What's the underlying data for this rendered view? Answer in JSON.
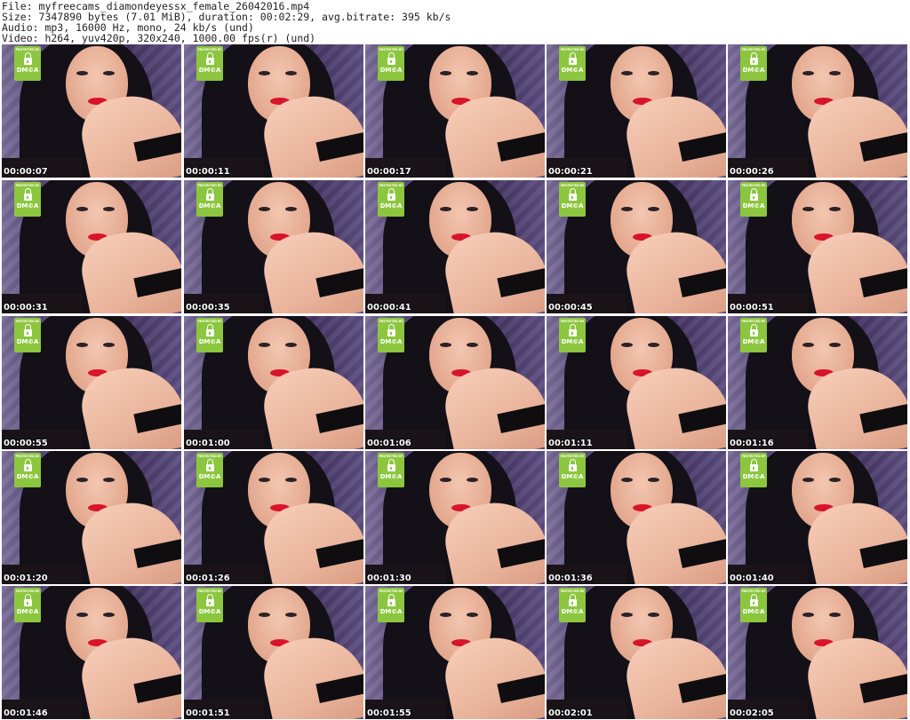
{
  "header": {
    "line1": "File: myfreecams_diamondeyessx_female_26042016.mp4",
    "line2": "Size: 7347890 bytes (7.01 MiB), duration: 00:02:29, avg.bitrate: 395 kb/s",
    "line3": "Audio: mp3, 16000 Hz, mono, 24 kb/s (und)",
    "line4": "Video: h264, yuv420p, 320x240, 1000.00 fps(r) (und)"
  },
  "badge": {
    "protected_label": "PROTECTED BY",
    "dmca_label": "DM©A",
    "color": "#8cc63f"
  },
  "thumbnails": [
    {
      "timestamp": "00:00:07"
    },
    {
      "timestamp": "00:00:11"
    },
    {
      "timestamp": "00:00:17"
    },
    {
      "timestamp": "00:00:21"
    },
    {
      "timestamp": "00:00:26"
    },
    {
      "timestamp": "00:00:31"
    },
    {
      "timestamp": "00:00:35"
    },
    {
      "timestamp": "00:00:41"
    },
    {
      "timestamp": "00:00:45"
    },
    {
      "timestamp": "00:00:51"
    },
    {
      "timestamp": "00:00:55"
    },
    {
      "timestamp": "00:01:00"
    },
    {
      "timestamp": "00:01:06"
    },
    {
      "timestamp": "00:01:11"
    },
    {
      "timestamp": "00:01:16"
    },
    {
      "timestamp": "00:01:20"
    },
    {
      "timestamp": "00:01:26"
    },
    {
      "timestamp": "00:01:30"
    },
    {
      "timestamp": "00:01:36"
    },
    {
      "timestamp": "00:01:40"
    },
    {
      "timestamp": "00:01:46"
    },
    {
      "timestamp": "00:01:51"
    },
    {
      "timestamp": "00:01:55"
    },
    {
      "timestamp": "00:02:01"
    },
    {
      "timestamp": "00:02:05"
    }
  ]
}
